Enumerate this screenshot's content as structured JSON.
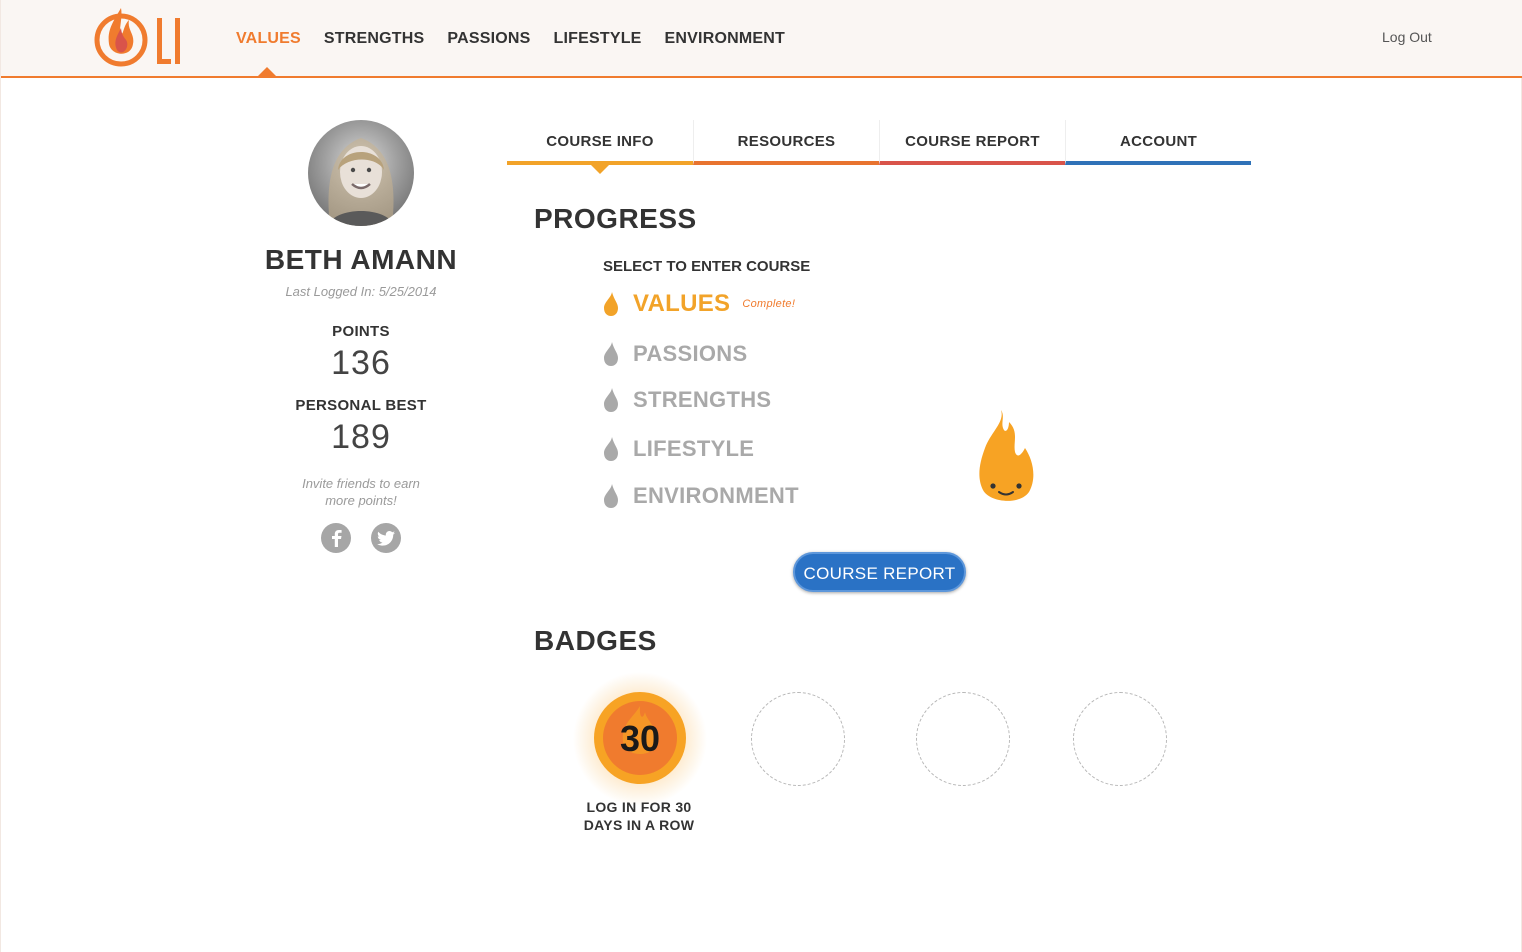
{
  "nav": {
    "items": [
      {
        "label": "VALUES",
        "active": true
      },
      {
        "label": "STRENGTHS",
        "active": false
      },
      {
        "label": "PASSIONS",
        "active": false
      },
      {
        "label": "LIFESTYLE",
        "active": false
      },
      {
        "label": "ENVIRONMENT",
        "active": false
      }
    ],
    "logout": "Log Out",
    "logo_icon": "flame-logo-icon"
  },
  "profile": {
    "name": "BETH AMANN",
    "last_logged": "Last Logged In: 5/25/2014",
    "points_label": "POINTS",
    "points": "136",
    "best_label": "PERSONAL BEST",
    "best": "189",
    "invite": "Invite friends to earn more points!",
    "social": [
      "facebook-icon",
      "twitter-icon"
    ]
  },
  "tabs": [
    {
      "label": "COURSE INFO",
      "color": "#f2a329",
      "active": true
    },
    {
      "label": "RESOURCES",
      "color": "#e8732f",
      "active": false
    },
    {
      "label": "COURSE REPORT",
      "color": "#d9544a",
      "active": false
    },
    {
      "label": "ACCOUNT",
      "color": "#2f72b8",
      "active": false
    }
  ],
  "progress": {
    "title": "PROGRESS",
    "select_label": "SELECT TO ENTER COURSE",
    "courses": [
      {
        "label": "VALUES",
        "status": "Complete!",
        "complete": true
      },
      {
        "label": "PASSIONS",
        "status": "",
        "complete": false
      },
      {
        "label": "STRENGTHS",
        "status": "",
        "complete": false
      },
      {
        "label": "LIFESTYLE",
        "status": "",
        "complete": false
      },
      {
        "label": "ENVIRONMENT",
        "status": "",
        "complete": false
      }
    ],
    "report_button": "COURSE REPORT"
  },
  "badges": {
    "title": "BADGES",
    "earned": {
      "number": "30",
      "label_line1": "LOG IN FOR 30",
      "label_line2": "DAYS IN A ROW"
    }
  },
  "colors": {
    "accent": "#f07b2e",
    "flame": "#f2a329",
    "inactive": "#a9a9a9",
    "button": "#2a72c5"
  }
}
